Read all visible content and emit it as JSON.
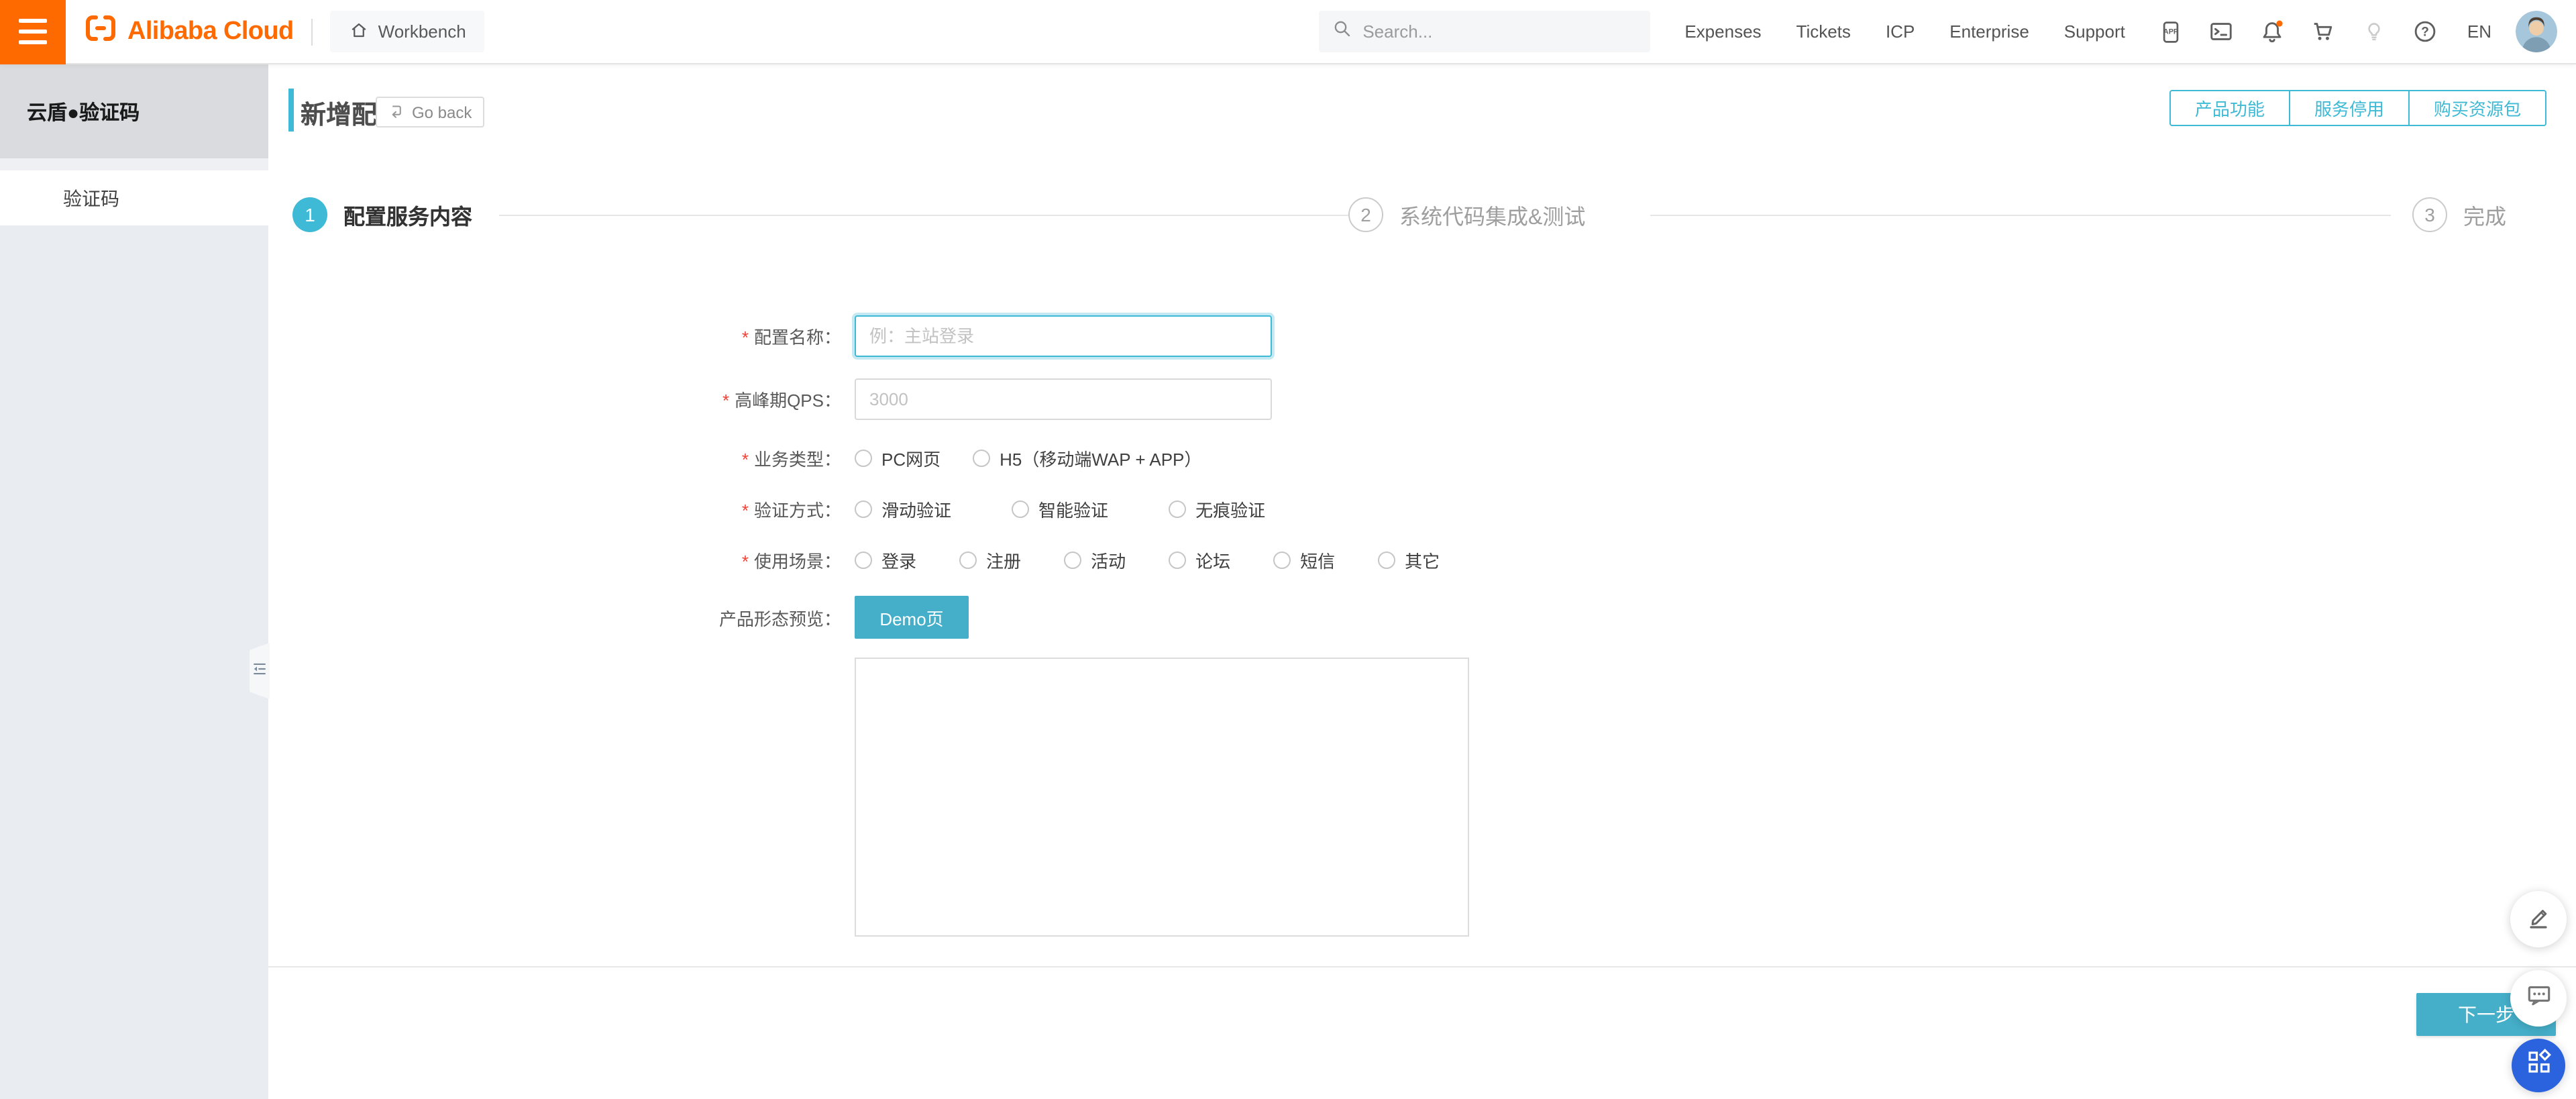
{
  "colors": {
    "brand_orange": "#FF6A00",
    "accent": "#3EBAD6",
    "accent_fill": "#45AFC9",
    "fab_blue": "#2A63DD"
  },
  "header": {
    "brand": "Alibaba Cloud",
    "workbench": "Workbench",
    "search_placeholder": "Search...",
    "nav": [
      "Expenses",
      "Tickets",
      "ICP",
      "Enterprise",
      "Support"
    ],
    "icons": [
      "app-icon",
      "console-icon",
      "notifications-icon",
      "cart-icon",
      "lightbulb-icon",
      "help-icon"
    ],
    "language": "EN"
  },
  "sidebar": {
    "product_title": "云盾●验证码",
    "items": [
      {
        "label": "验证码"
      }
    ]
  },
  "page": {
    "title": "新增配置",
    "go_back": "Go back",
    "actions": [
      "产品功能",
      "服务停用",
      "购买资源包"
    ]
  },
  "steps": [
    {
      "num": "1",
      "label": "配置服务内容"
    },
    {
      "num": "2",
      "label": "系统代码集成&测试"
    },
    {
      "num": "3",
      "label": "完成"
    }
  ],
  "form": {
    "required_mark": "*",
    "fields": [
      {
        "label": "配置名称：",
        "placeholder": "例：主站登录"
      },
      {
        "label": "高峰期QPS：",
        "placeholder": "3000"
      }
    ],
    "radio_groups": [
      {
        "label": "业务类型：",
        "options": [
          "PC网页",
          "H5（移动端WAP + APP）"
        ]
      },
      {
        "label": "验证方式：",
        "options": [
          "滑动验证",
          "智能验证",
          "无痕验证"
        ]
      },
      {
        "label": "使用场景：",
        "options": [
          "登录",
          "注册",
          "活动",
          "论坛",
          "短信",
          "其它"
        ]
      }
    ],
    "preview_label": "产品形态预览：",
    "demo_button": "Demo页"
  },
  "footer": {
    "next_button": "下一步"
  }
}
